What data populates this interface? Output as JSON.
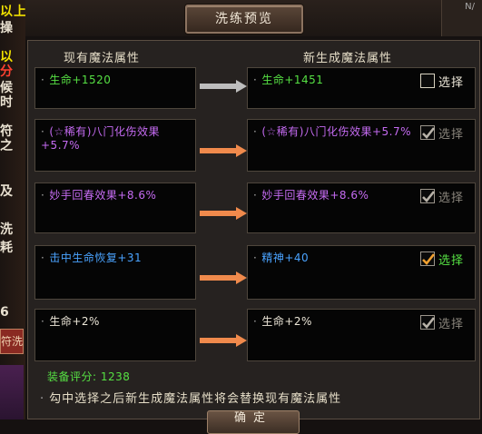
{
  "title": "洗练预览",
  "top_right_text": "N/",
  "headers": {
    "current": "现有魔法属性",
    "new": "新生成魔法属性"
  },
  "colors": {
    "green": "#56e043",
    "purple": "#c56bf2",
    "blue": "#4aa3ff",
    "arrow_orange": "#f08a4c",
    "arrow_gray": "#bdbdbd",
    "check_orange": "#f0a030"
  },
  "rows": [
    {
      "current": "生命+1520",
      "new": "生命+1451",
      "current_color": "green",
      "new_color": "green",
      "arrow": "gray",
      "checked": false,
      "enabled": true,
      "check_label": "选择"
    },
    {
      "current": "(☆稀有)八门化伤效果+5.7%",
      "new": "(☆稀有)八门化伤效果+5.7%",
      "current_color": "purple",
      "new_color": "purple",
      "arrow": "orange",
      "checked": true,
      "enabled": false,
      "check_label": "选择"
    },
    {
      "current": "妙手回春效果+8.6%",
      "new": "妙手回春效果+8.6%",
      "current_color": "purple",
      "new_color": "purple",
      "arrow": "orange",
      "checked": true,
      "enabled": false,
      "check_label": "选择"
    },
    {
      "current": "击中生命恢复+31",
      "new": "精神+40",
      "current_color": "blue",
      "new_color": "blue",
      "arrow": "orange",
      "checked": true,
      "enabled": true,
      "check_label": "选择"
    },
    {
      "current": "生命+2%",
      "new": "生命+2%",
      "current_color": "white",
      "new_color": "white",
      "arrow": "orange",
      "checked": true,
      "enabled": false,
      "check_label": "选择"
    }
  ],
  "score_label": "装备评分:",
  "score_value": "1238",
  "footnote": "勾中选择之后新生成魔法属性将会替换现有魔法属性",
  "confirm_label": "确定",
  "side_fragments": [
    "以上",
    "操",
    "以",
    "分",
    "候",
    "时",
    "符",
    "之",
    "及",
    "洗",
    "耗",
    "6",
    "符洗"
  ]
}
